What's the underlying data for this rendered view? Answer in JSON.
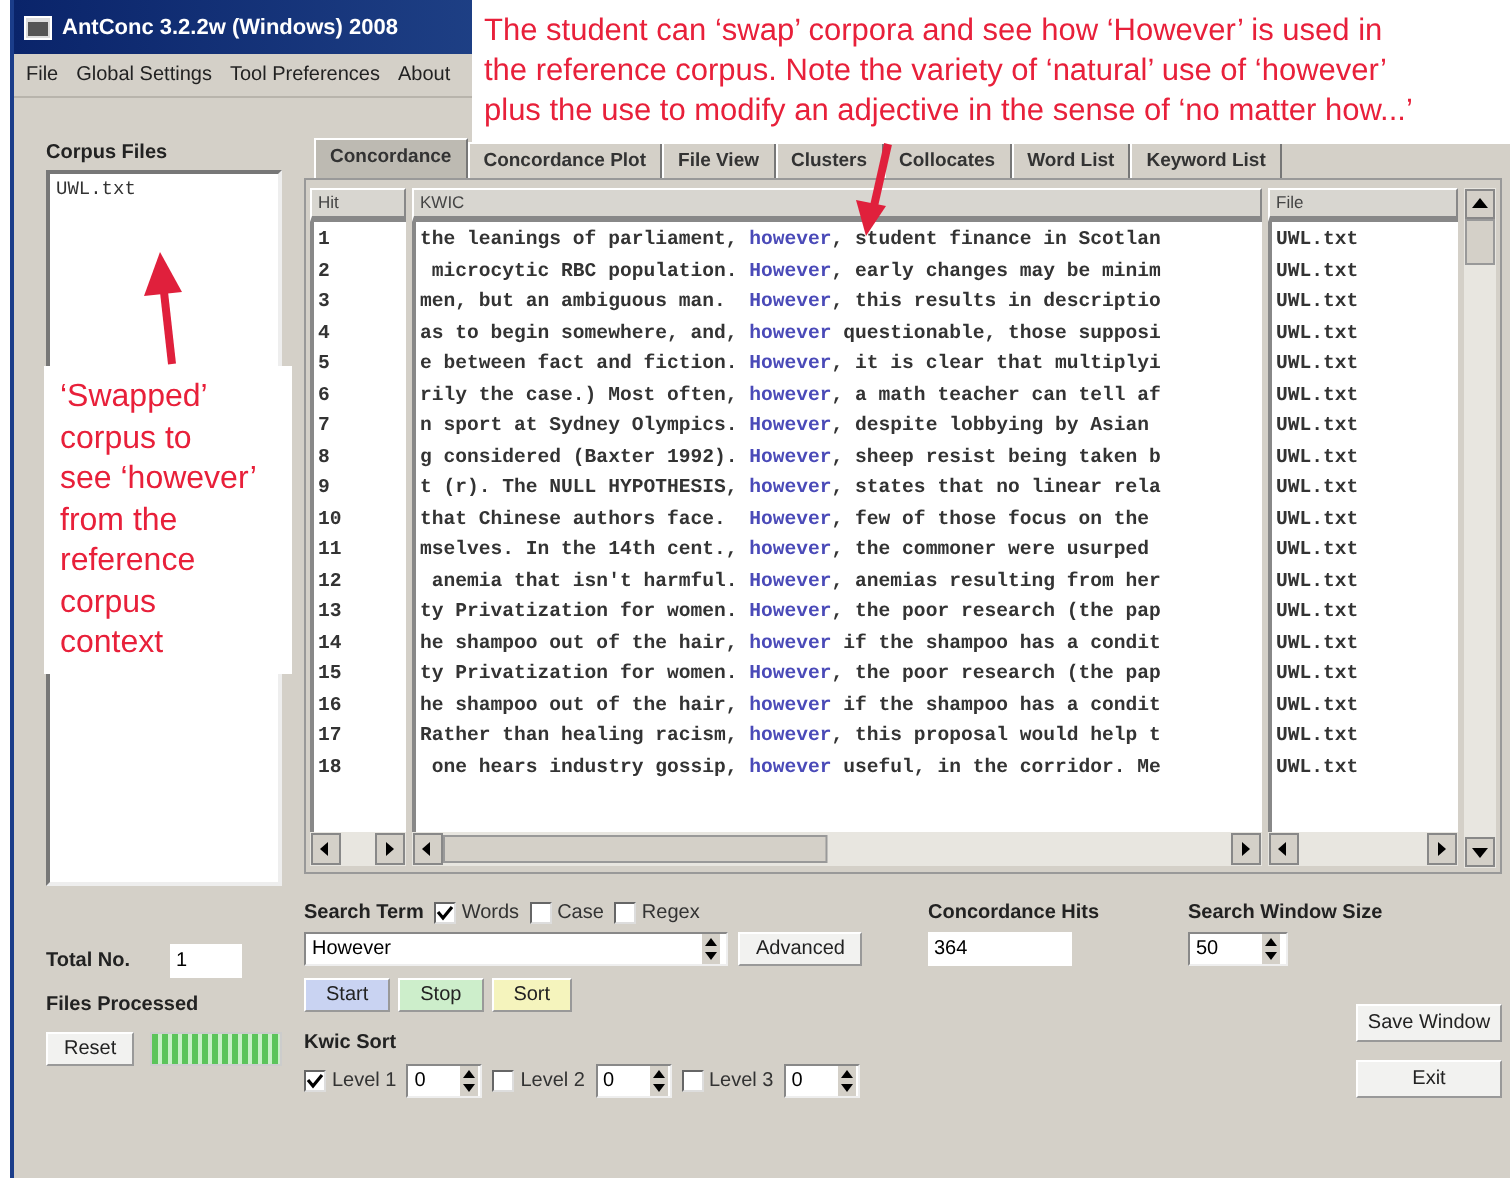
{
  "window": {
    "title": "AntConc 3.2.2w (Windows) 2008"
  },
  "menu": [
    "File",
    "Global Settings",
    "Tool Preferences",
    "About"
  ],
  "callouts": [
    {
      "lines": [
        "The student can ‘swap’ corpora and see how ‘However’ is used in",
        "the reference corpus. Note the variety of ‘natural’ use of ‘however’",
        "plus the use to modify an adjective in the sense of ‘no matter how...’"
      ]
    },
    {
      "lines": [
        "‘Swapped’",
        "corpus to",
        "see ‘however’",
        "from the",
        "reference",
        "corpus",
        "context"
      ]
    }
  ],
  "corpus_files": {
    "label": "Corpus Files",
    "files": [
      "UWL.txt"
    ]
  },
  "total": {
    "label": "Total No.",
    "value": "1"
  },
  "files_processed": {
    "label": "Files Processed",
    "level": 1
  },
  "reset_button": "Reset",
  "tabs": [
    {
      "label": "Concordance",
      "selected": true
    },
    {
      "label": "Concordance Plot",
      "selected": false
    },
    {
      "label": "File View",
      "selected": false
    },
    {
      "label": "Clusters",
      "selected": false
    },
    {
      "label": "Collocates",
      "selected": false
    },
    {
      "label": "Word List",
      "selected": false
    },
    {
      "label": "Keyword List",
      "selected": false
    }
  ],
  "table": {
    "columns": [
      "Hit",
      "KWIC",
      "File"
    ],
    "rows": [
      {
        "hit": "1",
        "left": "the leanings of parliament, ",
        "keyword": "however",
        "right": ", student finance in Scotlan",
        "file": "UWL.txt"
      },
      {
        "hit": "2",
        "left": " microcytic RBC population. ",
        "keyword": "However",
        "right": ", early changes may be minim",
        "file": "UWL.txt"
      },
      {
        "hit": "3",
        "left": "men, but an ambiguous man.  ",
        "keyword": "However",
        "right": ", this results in descriptio",
        "file": "UWL.txt"
      },
      {
        "hit": "4",
        "left": "as to begin somewhere, and, ",
        "keyword": "however",
        "right": " questionable, those supposi",
        "file": "UWL.txt"
      },
      {
        "hit": "5",
        "left": "e between fact and fiction. ",
        "keyword": "However",
        "right": ", it is clear that multiplyi",
        "file": "UWL.txt"
      },
      {
        "hit": "6",
        "left": "rily the case.) Most often, ",
        "keyword": "however",
        "right": ", a math teacher can tell af",
        "file": "UWL.txt"
      },
      {
        "hit": "7",
        "left": "n sport at Sydney Olympics. ",
        "keyword": "However",
        "right": ", despite lobbying by Asian",
        "file": "UWL.txt"
      },
      {
        "hit": "8",
        "left": "g considered (Baxter 1992). ",
        "keyword": "However",
        "right": ", sheep resist being taken b",
        "file": "UWL.txt"
      },
      {
        "hit": "9",
        "left": "t (r). The NULL HYPOTHESIS, ",
        "keyword": "however",
        "right": ", states that no linear rela",
        "file": "UWL.txt"
      },
      {
        "hit": "10",
        "left": "that Chinese authors face.  ",
        "keyword": "However",
        "right": ", few of those focus on the",
        "file": "UWL.txt"
      },
      {
        "hit": "11",
        "left": "mselves. In the 14th cent., ",
        "keyword": "however",
        "right": ", the commoner were usurped",
        "file": "UWL.txt"
      },
      {
        "hit": "12",
        "left": " anemia that isn't harmful. ",
        "keyword": "However",
        "right": ", anemias resulting from her",
        "file": "UWL.txt"
      },
      {
        "hit": "13",
        "left": "ty Privatization for women. ",
        "keyword": "However",
        "right": ", the poor research (the pap",
        "file": "UWL.txt"
      },
      {
        "hit": "14",
        "left": "he shampoo out of the hair, ",
        "keyword": "however",
        "right": " if the shampoo has a condit",
        "file": "UWL.txt"
      },
      {
        "hit": "15",
        "left": "ty Privatization for women. ",
        "keyword": "However",
        "right": ", the poor research (the pap",
        "file": "UWL.txt"
      },
      {
        "hit": "16",
        "left": "he shampoo out of the hair, ",
        "keyword": "however",
        "right": " if the shampoo has a condit",
        "file": "UWL.txt"
      },
      {
        "hit": "17",
        "left": "Rather than healing racism, ",
        "keyword": "however",
        "right": ", this proposal would help t",
        "file": "UWL.txt"
      },
      {
        "hit": "18",
        "left": " one hears industry gossip, ",
        "keyword": "however",
        "right": " useful, in the corridor. Me",
        "file": "UWL.txt"
      }
    ]
  },
  "search": {
    "label": "Search Term",
    "options": [
      {
        "label": "Words",
        "checked": true
      },
      {
        "label": "Case",
        "checked": false
      },
      {
        "label": "Regex",
        "checked": false
      }
    ],
    "value": "However",
    "advanced_button": "Advanced"
  },
  "actions": [
    {
      "label": "Start",
      "color": "#c9d3f2"
    },
    {
      "label": "Stop",
      "color": "#cdeecb"
    },
    {
      "label": "Sort",
      "color": "#f5f4bd"
    }
  ],
  "hits": {
    "label": "Concordance Hits",
    "value": "364"
  },
  "window_size": {
    "label": "Search Window Size",
    "value": "50"
  },
  "kwic_sort": {
    "label": "Kwic Sort",
    "levels": [
      {
        "label": "Level 1",
        "checked": true,
        "value": "0"
      },
      {
        "label": "Level 2",
        "checked": false,
        "value": "0"
      },
      {
        "label": "Level 3",
        "checked": false,
        "value": "0"
      }
    ]
  },
  "side_buttons": [
    "Save Window",
    "Exit"
  ]
}
